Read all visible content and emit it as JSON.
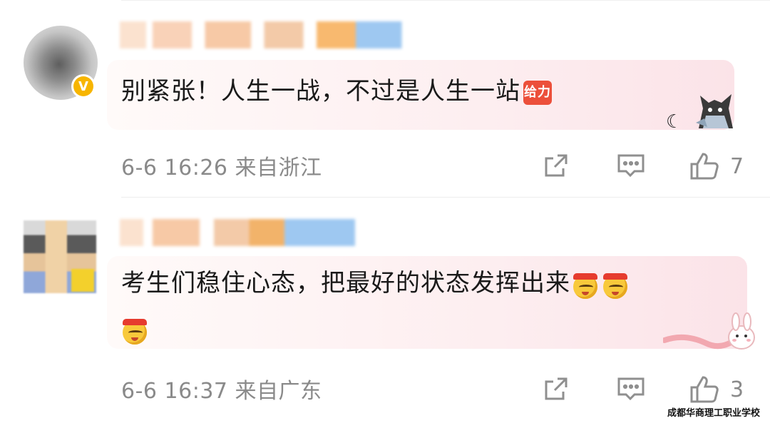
{
  "comments": [
    {
      "text": "别紧张！人生一战，不过是人生一站",
      "sticker_label": "给力",
      "time": "6-6 16:26",
      "location": "来自浙江",
      "likes": "7"
    },
    {
      "text": "考生们稳住心态，把最好的状态发挥出来",
      "time": "6-6 16:37",
      "location": "来自广东",
      "likes": "3"
    }
  ],
  "watermark": "成都华商理工职业学校",
  "icons": {
    "share": "share-icon",
    "comment": "comment-icon",
    "like": "thumbs-up-icon",
    "verified": "verified-badge-icon"
  },
  "colors": {
    "verified": "#f7b500",
    "sticker": "#ec4f3a",
    "meta_text": "#8a8a8a"
  }
}
